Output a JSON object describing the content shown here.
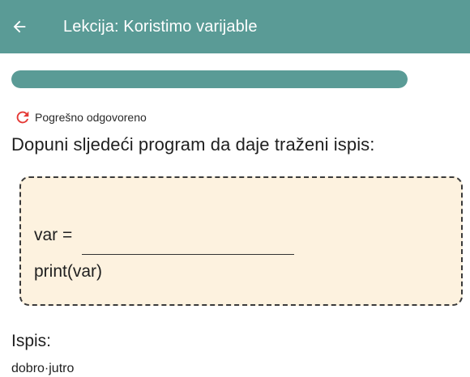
{
  "header": {
    "title": "Lekcija: Koristimo varijable",
    "back_icon": "arrow-left-icon",
    "background": "#5a9b96"
  },
  "progress": {
    "value": 1.0,
    "color": "#5a9b96"
  },
  "status": {
    "icon": "retry-icon",
    "text": "Pogrešno odgovoreno",
    "icon_color": "#e53935"
  },
  "question": {
    "text": "Dopuni sljedeći program da daje traženi ispis:"
  },
  "code": {
    "line1_prefix": "var =",
    "blank_value": "",
    "line2": "print(var)",
    "background": "#fdf2df"
  },
  "output": {
    "label": "Ispis:",
    "value": "dobro·jutro"
  }
}
